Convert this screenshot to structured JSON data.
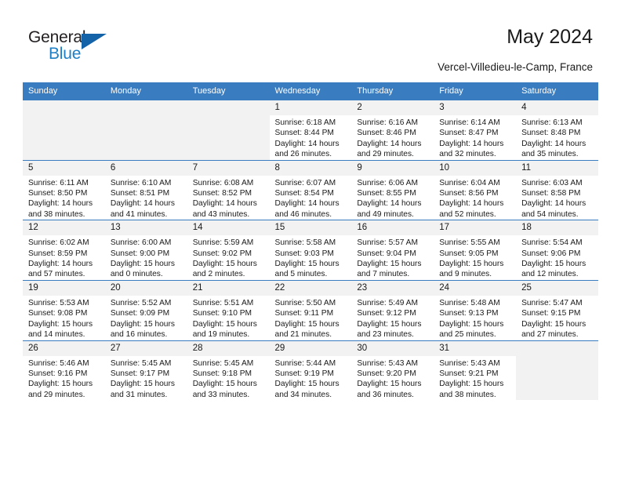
{
  "brand": {
    "name_part1": "General",
    "name_part2": "Blue",
    "accent_color": "#1462a8",
    "text_color": "#231f20"
  },
  "header": {
    "title": "May 2024",
    "subtitle": "Vercel-Villedieu-le-Camp, France",
    "header_background": "#3a7cc0"
  },
  "calendar": {
    "weekday_headers": [
      "Sunday",
      "Monday",
      "Tuesday",
      "Wednesday",
      "Thursday",
      "Friday",
      "Saturday"
    ],
    "labels": {
      "sunrise": "Sunrise:",
      "sunset": "Sunset:",
      "daylight": "Daylight:"
    },
    "weeks": [
      [
        {
          "day": "",
          "sunrise": "",
          "sunset": "",
          "daylight": ""
        },
        {
          "day": "",
          "sunrise": "",
          "sunset": "",
          "daylight": ""
        },
        {
          "day": "",
          "sunrise": "",
          "sunset": "",
          "daylight": ""
        },
        {
          "day": "1",
          "sunrise": "Sunrise: 6:18 AM",
          "sunset": "Sunset: 8:44 PM",
          "daylight": "Daylight: 14 hours and 26 minutes."
        },
        {
          "day": "2",
          "sunrise": "Sunrise: 6:16 AM",
          "sunset": "Sunset: 8:46 PM",
          "daylight": "Daylight: 14 hours and 29 minutes."
        },
        {
          "day": "3",
          "sunrise": "Sunrise: 6:14 AM",
          "sunset": "Sunset: 8:47 PM",
          "daylight": "Daylight: 14 hours and 32 minutes."
        },
        {
          "day": "4",
          "sunrise": "Sunrise: 6:13 AM",
          "sunset": "Sunset: 8:48 PM",
          "daylight": "Daylight: 14 hours and 35 minutes."
        }
      ],
      [
        {
          "day": "5",
          "sunrise": "Sunrise: 6:11 AM",
          "sunset": "Sunset: 8:50 PM",
          "daylight": "Daylight: 14 hours and 38 minutes."
        },
        {
          "day": "6",
          "sunrise": "Sunrise: 6:10 AM",
          "sunset": "Sunset: 8:51 PM",
          "daylight": "Daylight: 14 hours and 41 minutes."
        },
        {
          "day": "7",
          "sunrise": "Sunrise: 6:08 AM",
          "sunset": "Sunset: 8:52 PM",
          "daylight": "Daylight: 14 hours and 43 minutes."
        },
        {
          "day": "8",
          "sunrise": "Sunrise: 6:07 AM",
          "sunset": "Sunset: 8:54 PM",
          "daylight": "Daylight: 14 hours and 46 minutes."
        },
        {
          "day": "9",
          "sunrise": "Sunrise: 6:06 AM",
          "sunset": "Sunset: 8:55 PM",
          "daylight": "Daylight: 14 hours and 49 minutes."
        },
        {
          "day": "10",
          "sunrise": "Sunrise: 6:04 AM",
          "sunset": "Sunset: 8:56 PM",
          "daylight": "Daylight: 14 hours and 52 minutes."
        },
        {
          "day": "11",
          "sunrise": "Sunrise: 6:03 AM",
          "sunset": "Sunset: 8:58 PM",
          "daylight": "Daylight: 14 hours and 54 minutes."
        }
      ],
      [
        {
          "day": "12",
          "sunrise": "Sunrise: 6:02 AM",
          "sunset": "Sunset: 8:59 PM",
          "daylight": "Daylight: 14 hours and 57 minutes."
        },
        {
          "day": "13",
          "sunrise": "Sunrise: 6:00 AM",
          "sunset": "Sunset: 9:00 PM",
          "daylight": "Daylight: 15 hours and 0 minutes."
        },
        {
          "day": "14",
          "sunrise": "Sunrise: 5:59 AM",
          "sunset": "Sunset: 9:02 PM",
          "daylight": "Daylight: 15 hours and 2 minutes."
        },
        {
          "day": "15",
          "sunrise": "Sunrise: 5:58 AM",
          "sunset": "Sunset: 9:03 PM",
          "daylight": "Daylight: 15 hours and 5 minutes."
        },
        {
          "day": "16",
          "sunrise": "Sunrise: 5:57 AM",
          "sunset": "Sunset: 9:04 PM",
          "daylight": "Daylight: 15 hours and 7 minutes."
        },
        {
          "day": "17",
          "sunrise": "Sunrise: 5:55 AM",
          "sunset": "Sunset: 9:05 PM",
          "daylight": "Daylight: 15 hours and 9 minutes."
        },
        {
          "day": "18",
          "sunrise": "Sunrise: 5:54 AM",
          "sunset": "Sunset: 9:06 PM",
          "daylight": "Daylight: 15 hours and 12 minutes."
        }
      ],
      [
        {
          "day": "19",
          "sunrise": "Sunrise: 5:53 AM",
          "sunset": "Sunset: 9:08 PM",
          "daylight": "Daylight: 15 hours and 14 minutes."
        },
        {
          "day": "20",
          "sunrise": "Sunrise: 5:52 AM",
          "sunset": "Sunset: 9:09 PM",
          "daylight": "Daylight: 15 hours and 16 minutes."
        },
        {
          "day": "21",
          "sunrise": "Sunrise: 5:51 AM",
          "sunset": "Sunset: 9:10 PM",
          "daylight": "Daylight: 15 hours and 19 minutes."
        },
        {
          "day": "22",
          "sunrise": "Sunrise: 5:50 AM",
          "sunset": "Sunset: 9:11 PM",
          "daylight": "Daylight: 15 hours and 21 minutes."
        },
        {
          "day": "23",
          "sunrise": "Sunrise: 5:49 AM",
          "sunset": "Sunset: 9:12 PM",
          "daylight": "Daylight: 15 hours and 23 minutes."
        },
        {
          "day": "24",
          "sunrise": "Sunrise: 5:48 AM",
          "sunset": "Sunset: 9:13 PM",
          "daylight": "Daylight: 15 hours and 25 minutes."
        },
        {
          "day": "25",
          "sunrise": "Sunrise: 5:47 AM",
          "sunset": "Sunset: 9:15 PM",
          "daylight": "Daylight: 15 hours and 27 minutes."
        }
      ],
      [
        {
          "day": "26",
          "sunrise": "Sunrise: 5:46 AM",
          "sunset": "Sunset: 9:16 PM",
          "daylight": "Daylight: 15 hours and 29 minutes."
        },
        {
          "day": "27",
          "sunrise": "Sunrise: 5:45 AM",
          "sunset": "Sunset: 9:17 PM",
          "daylight": "Daylight: 15 hours and 31 minutes."
        },
        {
          "day": "28",
          "sunrise": "Sunrise: 5:45 AM",
          "sunset": "Sunset: 9:18 PM",
          "daylight": "Daylight: 15 hours and 33 minutes."
        },
        {
          "day": "29",
          "sunrise": "Sunrise: 5:44 AM",
          "sunset": "Sunset: 9:19 PM",
          "daylight": "Daylight: 15 hours and 34 minutes."
        },
        {
          "day": "30",
          "sunrise": "Sunrise: 5:43 AM",
          "sunset": "Sunset: 9:20 PM",
          "daylight": "Daylight: 15 hours and 36 minutes."
        },
        {
          "day": "31",
          "sunrise": "Sunrise: 5:43 AM",
          "sunset": "Sunset: 9:21 PM",
          "daylight": "Daylight: 15 hours and 38 minutes."
        },
        {
          "day": "",
          "sunrise": "",
          "sunset": "",
          "daylight": ""
        }
      ]
    ]
  }
}
